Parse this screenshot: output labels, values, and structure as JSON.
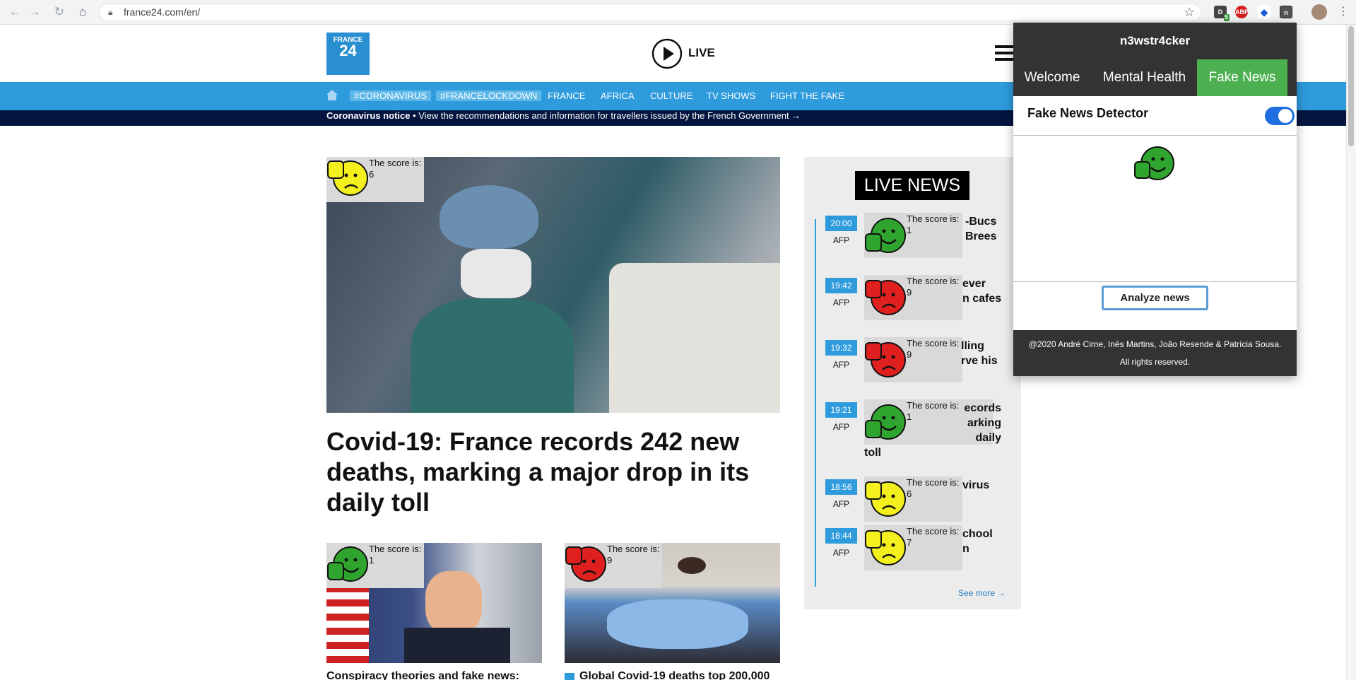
{
  "browser": {
    "url": "france24.com/en/",
    "ext_badge": "5",
    "ext_abp": "ABP",
    "ext_n": "n"
  },
  "site": {
    "logo_line1": "FRANCE",
    "logo_line2": "24",
    "live_label": "LIVE",
    "nav": [
      "#CORONAVIRUS",
      "#FRANCELOCKDOWN",
      "FRANCE",
      "AFRICA",
      "CULTURE",
      "TV SHOWS",
      "FIGHT THE FAKE"
    ],
    "notice_bold": "Coronavirus notice",
    "notice_text": " • View the recommendations and information for travellers issued by the French Government →"
  },
  "main": {
    "score_label": "The score is:",
    "score": "6",
    "headline": "Covid-19: France records 242 new deaths, marking a major drop in its daily toll"
  },
  "cards": [
    {
      "score_label": "The score is:",
      "score": "1",
      "title": "Conspiracy theories and fake news:"
    },
    {
      "score_label": "The score is:",
      "score": "9",
      "title": "Global Covid-19 deaths top 200,000"
    }
  ],
  "live": {
    "title": "LIVE NEWS",
    "see_more": "See more →",
    "score_label": "The score is:",
    "items": [
      {
        "time": "20:00",
        "source": "AFP",
        "score": "1",
        "line1": "-Bucs",
        "line2": "Brees",
        "line3": "",
        "line4": ""
      },
      {
        "time": "19:42",
        "source": "AFP",
        "score": "9",
        "line1": "ever",
        "line2": "n cafes",
        "line3": "",
        "line4": ""
      },
      {
        "time": "19:32",
        "source": "AFP",
        "score": "9",
        "line1": "lling",
        "line2": "rve his",
        "line3": "",
        "line4": ""
      },
      {
        "time": "19:21",
        "source": "AFP",
        "score": "1",
        "line1": "ecords",
        "line2": "arking",
        "line3": "daily",
        "line4": "toll"
      },
      {
        "time": "18:56",
        "source": "AFP",
        "score": "6",
        "line1": "virus",
        "line2": "",
        "line3": "",
        "line4": ""
      },
      {
        "time": "18:44",
        "source": "AFP",
        "score": "7",
        "line1": "chool",
        "line2": "n",
        "line3": "",
        "line4": ""
      }
    ]
  },
  "popup": {
    "app_name": "n3wstr4cker",
    "tabs": [
      "Welcome",
      "Mental Health",
      "Fake News"
    ],
    "active_tab": "Fake News",
    "detector_label": "Fake News Detector",
    "toggle_on": true,
    "analyze_label": "Analyze news",
    "footer_line1": "@2020 André Cirne, Inês Martins, João Resende & Patrícia Sousa.",
    "footer_line2": "All rights reserved."
  },
  "colors": {
    "good": "#2fa52f",
    "bad": "#e0201f",
    "neutral": "#f3f01e",
    "nav_blue": "#2e9bdc",
    "active_tab": "#4caf50"
  },
  "icons": {
    "thumbs_up": "thumbs-up-smiley-icon",
    "thumbs_down": "thumbs-down-frown-icon",
    "play": "play-icon",
    "home": "home-icon",
    "burger": "menu-icon",
    "star": "star-icon",
    "lock": "lock-icon"
  }
}
